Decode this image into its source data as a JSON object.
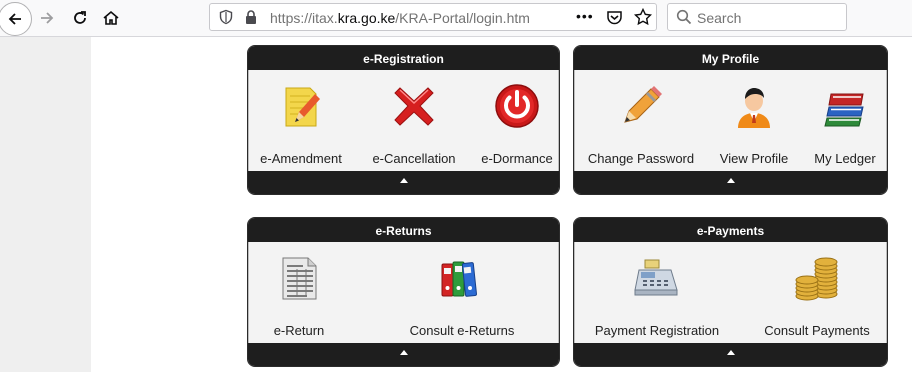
{
  "browser": {
    "url_prefix": "https://itax.",
    "url_domain": "kra.go.ke",
    "url_path": "/KRA-Portal/login.htm",
    "search_placeholder": "Search",
    "more_label": "•••"
  },
  "panels": {
    "registration": {
      "title": "e-Registration",
      "items": [
        "e-Amendment",
        "e-Cancellation",
        "e-Dormance"
      ]
    },
    "profile": {
      "title": "My Profile",
      "items": [
        "Change Password",
        "View Profile",
        "My Ledger"
      ]
    },
    "returns": {
      "title": "e-Returns",
      "items": [
        "e-Return",
        "Consult e-Returns"
      ]
    },
    "payments": {
      "title": "e-Payments",
      "items": [
        "Payment Registration",
        "Consult Payments"
      ]
    }
  },
  "colors": {
    "panel_header": "#1e1e1e",
    "panel_body": "#f3f3f3",
    "icon_red": "#d61f1f",
    "icon_yellow": "#f3d64b"
  }
}
